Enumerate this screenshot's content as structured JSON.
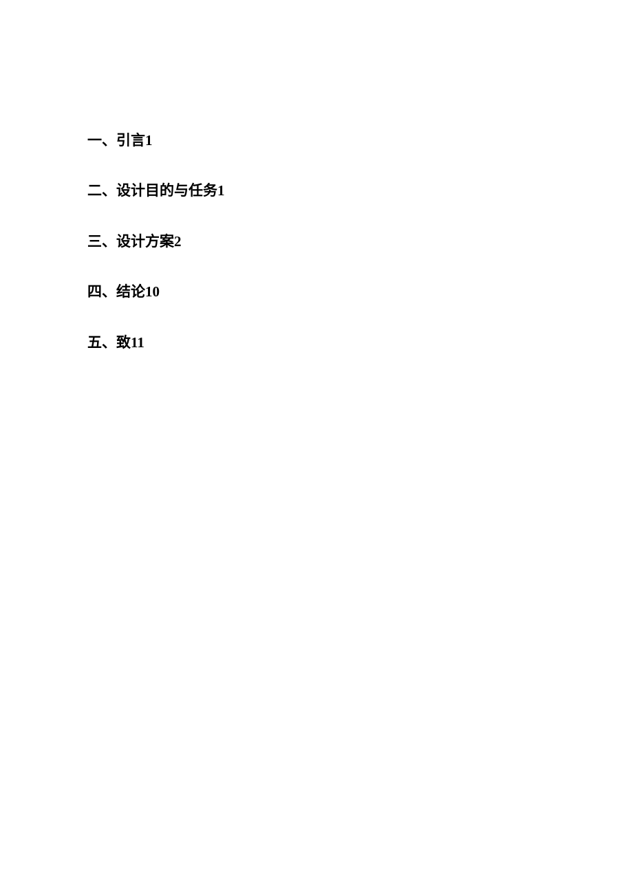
{
  "toc": {
    "entries": [
      {
        "label": "一、引言",
        "page": "1"
      },
      {
        "label": "二、设计目的与任务",
        "page": "1"
      },
      {
        "label": "三、设计方案",
        "page": "2"
      },
      {
        "label": "四、结论",
        "page": "10"
      },
      {
        "label": "五、致",
        "page": "11"
      }
    ]
  }
}
